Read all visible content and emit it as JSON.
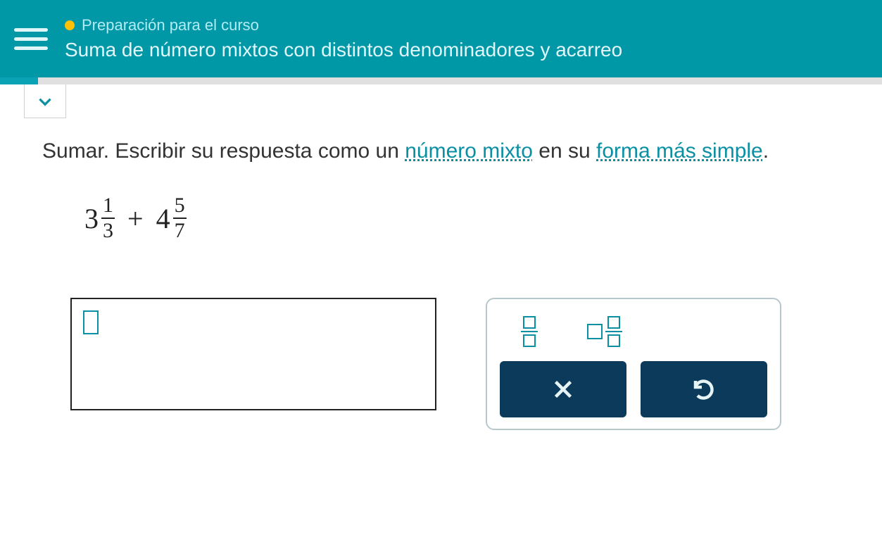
{
  "header": {
    "breadcrumb": "Preparación para el curso",
    "title": "Suma de número mixtos con distintos denominadores y acarreo"
  },
  "instruction": {
    "prefix": "Sumar. Escribir su respuesta como un ",
    "link1": "número mixto",
    "middle": " en su ",
    "link2": "forma más simple",
    "suffix": "."
  },
  "expression": {
    "term1_whole": "3",
    "term1_num": "1",
    "term1_den": "3",
    "operator": "+",
    "term2_whole": "4",
    "term2_num": "5",
    "term2_den": "7"
  }
}
